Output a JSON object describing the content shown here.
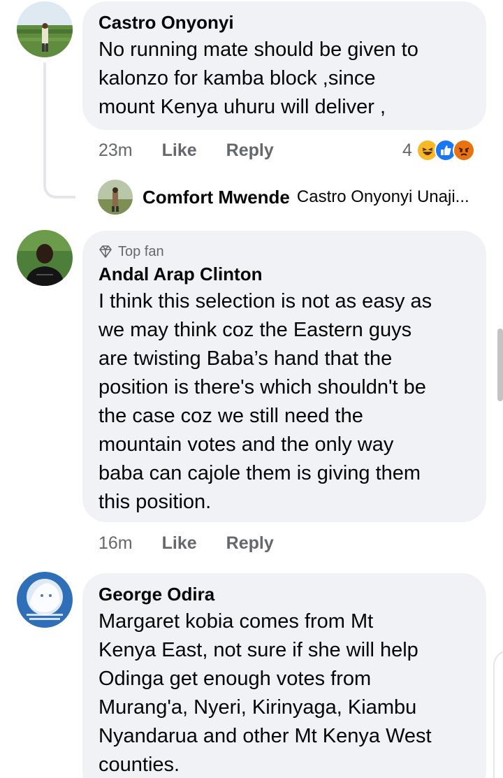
{
  "comments": [
    {
      "author": "Castro Onyonyi",
      "text_lines": [
        "No running mate should be given to",
        "kalonzo for kamba block ,since",
        "mount Kenya uhuru will deliver ,"
      ],
      "time": "23m",
      "like_label": "Like",
      "reply_label": "Reply",
      "reaction_count": "4",
      "reactions": [
        "haha-icon",
        "like-icon",
        "angry-icon"
      ]
    },
    {
      "badge": "Top fan",
      "author": "Andal Arap Clinton",
      "text_lines": [
        "I think this selection is not as easy as",
        "we may think coz the Eastern guys",
        "are twisting Baba’s hand that the",
        "position is there's which shouldn't be",
        "the case coz we still need the",
        "mountain votes and the only way",
        "baba can cajole them is giving them",
        "this position."
      ],
      "time": "16m",
      "like_label": "Like",
      "reply_label": "Reply"
    },
    {
      "author": "George Odira",
      "text_lines": [
        "Margaret kobia comes from Mt",
        "Kenya East, not sure if she will help",
        "Odinga get enough votes from",
        "Murang'a, Nyeri, Kirinyaga, Kiambu",
        "Nyandarua and other Mt Kenya West",
        "counties."
      ]
    }
  ],
  "reply_preview": {
    "author": "Comfort Mwende",
    "snippet": "Castro Onyonyi Unaji..."
  },
  "colors": {
    "bubble": "#f0f2f5",
    "meta_text": "#65676b",
    "like_blue": "#1877f2",
    "haha_yellow": "#f7b928",
    "angry_red": "#e9710f"
  }
}
